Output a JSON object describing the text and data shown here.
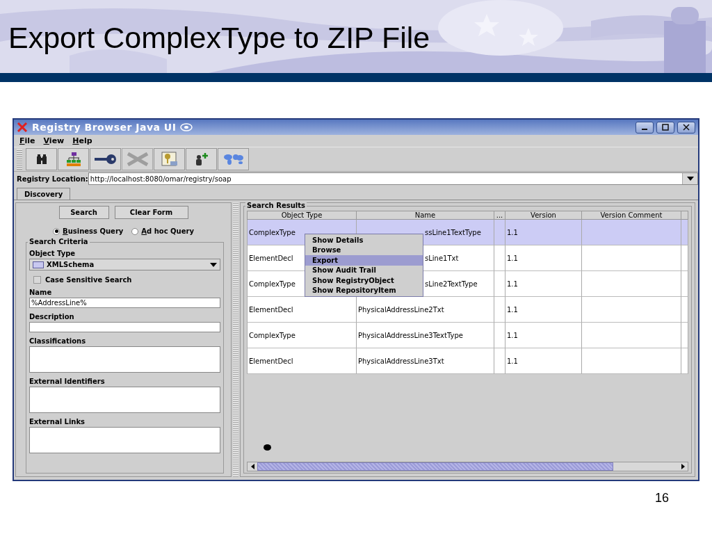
{
  "slide": {
    "title": "Export ComplexType to ZIP File",
    "page_number": "16"
  },
  "window": {
    "title": "Registry Browser Java UI"
  },
  "menu_bar": [
    {
      "mnemonic": "F",
      "rest": "ile"
    },
    {
      "mnemonic": "V",
      "rest": "iew"
    },
    {
      "mnemonic": "H",
      "rest": "elp"
    }
  ],
  "toolbar": [
    {
      "kind": "binoculars",
      "disabled": false
    },
    {
      "kind": "hierarchy",
      "disabled": false
    },
    {
      "kind": "key",
      "disabled": false
    },
    {
      "kind": "cross",
      "disabled": true
    },
    {
      "kind": "key-document",
      "disabled": false
    },
    {
      "kind": "user-add",
      "disabled": false
    },
    {
      "kind": "world-map",
      "disabled": false
    }
  ],
  "registry_location": {
    "label": "Registry Location:",
    "value": "http://localhost:8080/omar/registry/soap"
  },
  "tabs": [
    {
      "label": "Discovery",
      "selected": true
    }
  ],
  "search_panel": {
    "buttons": [
      "Search",
      "Clear Form"
    ],
    "query_types": [
      {
        "mnemonic": "B",
        "rest": "usiness Query",
        "selected": true
      },
      {
        "mnemonic": "A",
        "rest": "d hoc Query",
        "selected": false
      }
    ],
    "criteria_title": "Search Criteria",
    "object_type": {
      "label": "Object Type",
      "value": "XMLSchema"
    },
    "case_sensitive": {
      "label": "Case Sensitive Search",
      "checked": false
    },
    "name": {
      "label": "Name",
      "value": "%AddressLine%"
    },
    "description": {
      "label": "Description"
    },
    "classifications": {
      "label": "Classifications"
    },
    "external_identifiers": {
      "label": "External Identifiers"
    },
    "external_links": {
      "label": "External Links"
    }
  },
  "results": {
    "title": "Search Results",
    "columns": [
      "Object Type",
      "Name",
      "...",
      "Version",
      "Version Comment"
    ],
    "rows": [
      {
        "object_type": "ComplexType",
        "name": "ssLine1TextType",
        "clipped": true,
        "version": "1.1",
        "selected": true
      },
      {
        "object_type": "ElementDecl",
        "name": "sLine1Txt",
        "clipped": true,
        "version": "1.1",
        "selected": false
      },
      {
        "object_type": "ComplexType",
        "name": "sLine2TextType",
        "clipped": true,
        "version": "1.1",
        "selected": false
      },
      {
        "object_type": "ElementDecl",
        "name": "PhysicalAddressLine2Txt",
        "clipped": false,
        "version": "1.1",
        "selected": false
      },
      {
        "object_type": "ComplexType",
        "name": "PhysicalAddressLine3TextType",
        "clipped": false,
        "version": "1.1",
        "selected": false
      },
      {
        "object_type": "ElementDecl",
        "name": "PhysicalAddressLine3Txt",
        "clipped": false,
        "version": "1.1",
        "selected": false
      }
    ],
    "context_menu": [
      {
        "label": "Show Details",
        "selected": false
      },
      {
        "label": "Browse",
        "selected": false
      },
      {
        "label": "Export",
        "selected": true
      },
      {
        "label": "Show Audit Trail",
        "selected": false
      },
      {
        "label": "Show RegistryObject",
        "selected": false
      },
      {
        "label": "Show RepositoryItem",
        "selected": false
      }
    ]
  }
}
